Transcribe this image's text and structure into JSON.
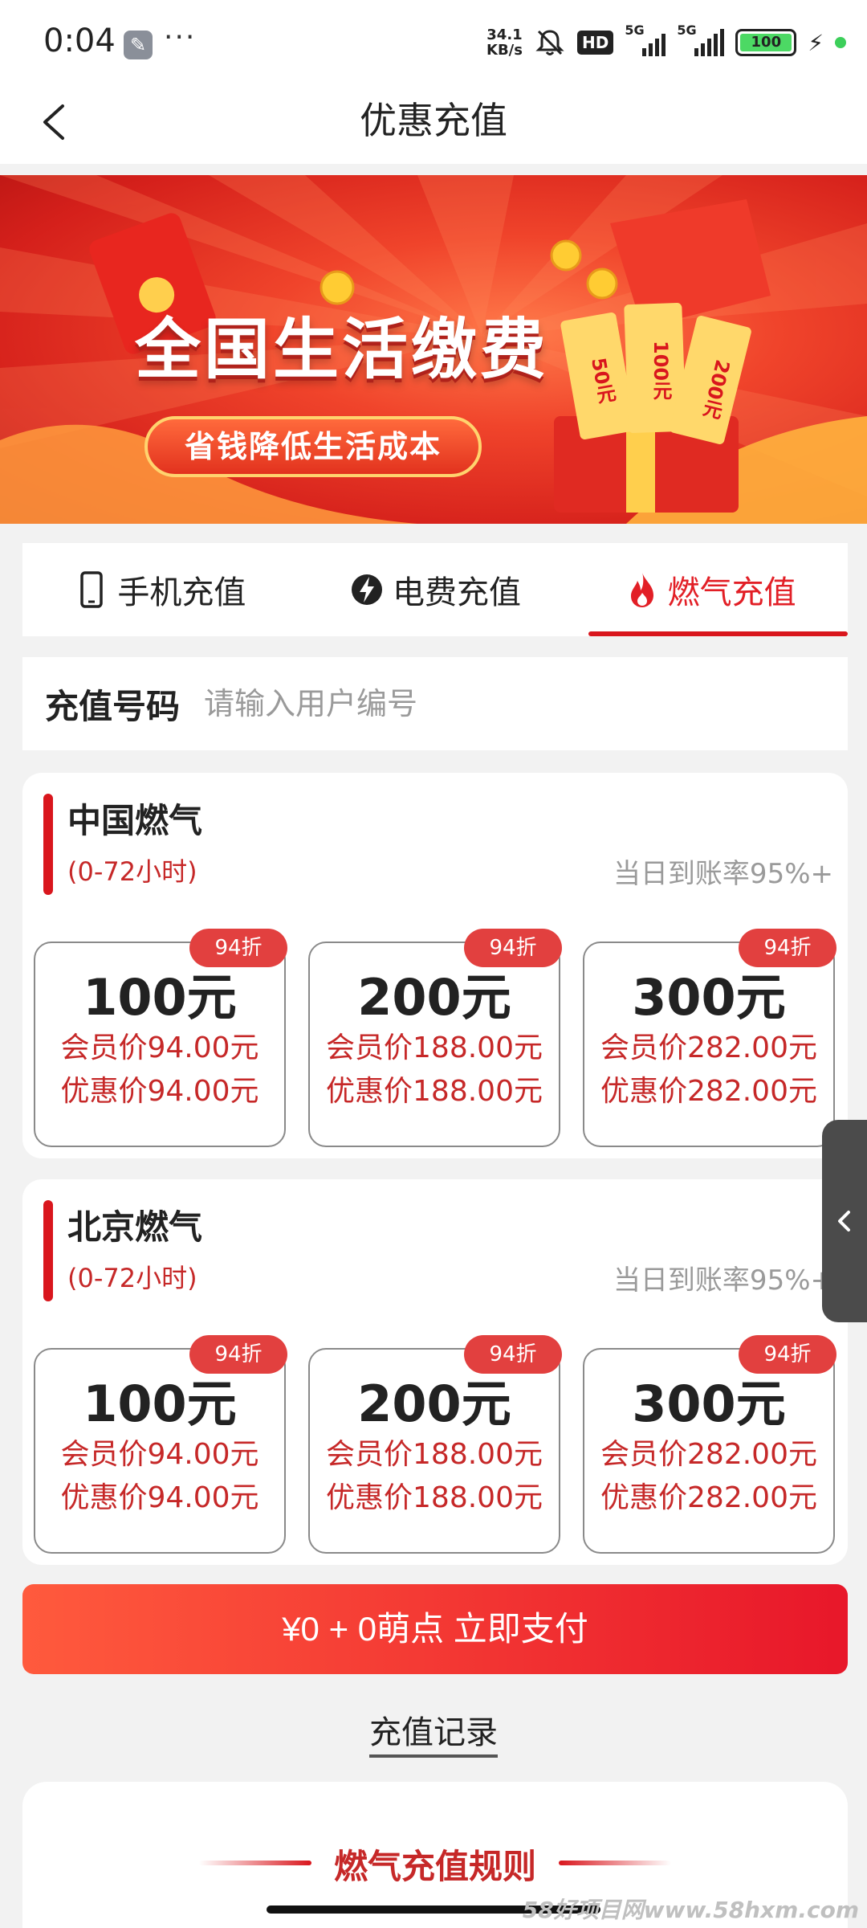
{
  "status_bar": {
    "time": "0:04",
    "dots": "···",
    "net_speed_value": "34.1",
    "net_speed_unit": "KB/s",
    "hd": "HD",
    "sig1": "5G",
    "sig2": "5G",
    "battery": "100"
  },
  "header": {
    "title": "优惠充值"
  },
  "banner": {
    "title": "全国生活缴费",
    "subtitle": "省钱降低生活成本",
    "coupons": [
      "50元",
      "100元",
      "200元"
    ]
  },
  "tabs": [
    {
      "label": "手机充值",
      "icon": "phone-icon",
      "active": false
    },
    {
      "label": "电费充值",
      "icon": "lightning-icon",
      "active": false
    },
    {
      "label": "燃气充值",
      "icon": "flame-icon",
      "active": true
    }
  ],
  "account": {
    "label": "充值号码",
    "placeholder": "请输入用户编号"
  },
  "providers": [
    {
      "name": "中国燃气",
      "time": "(0-72小时)",
      "rate": "当日到账率95%+",
      "options": [
        {
          "badge": "94折",
          "amount": "100元",
          "member": "会员价94.00元",
          "promo": "优惠价94.00元"
        },
        {
          "badge": "94折",
          "amount": "200元",
          "member": "会员价188.00元",
          "promo": "优惠价188.00元"
        },
        {
          "badge": "94折",
          "amount": "300元",
          "member": "会员价282.00元",
          "promo": "优惠价282.00元"
        }
      ]
    },
    {
      "name": "北京燃气",
      "time": "(0-72小时)",
      "rate": "当日到账率95%+",
      "options": [
        {
          "badge": "94折",
          "amount": "100元",
          "member": "会员价94.00元",
          "promo": "优惠价94.00元"
        },
        {
          "badge": "94折",
          "amount": "200元",
          "member": "会员价188.00元",
          "promo": "优惠价188.00元"
        },
        {
          "badge": "94折",
          "amount": "300元",
          "member": "会员价282.00元",
          "promo": "优惠价282.00元"
        }
      ]
    }
  ],
  "pay": {
    "label": "¥0 + 0萌点 立即支付"
  },
  "records": {
    "label": "充值记录"
  },
  "rules": {
    "title": "燃气充值规则"
  },
  "watermark": "58好项目网www.58hxm.com",
  "colors": {
    "accent": "#d9161d",
    "price_red": "#c62828",
    "badge": "#e2403f"
  }
}
